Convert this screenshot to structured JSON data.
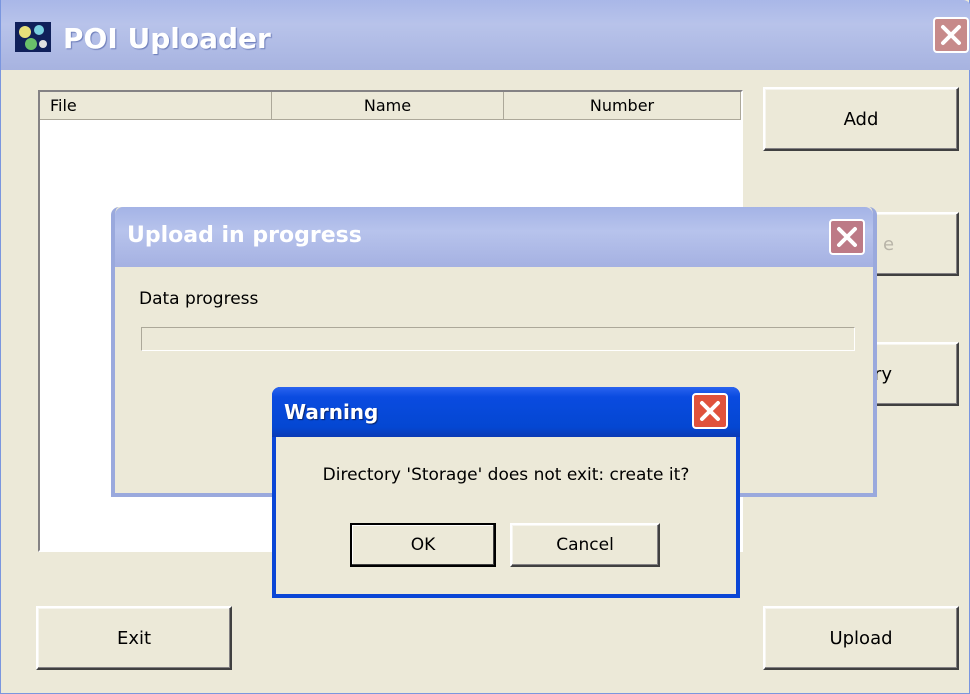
{
  "main_window": {
    "title": "POI Uploader",
    "icons": {
      "app": "poi-app-icon",
      "close": "close-icon"
    },
    "list_columns": [
      "File",
      "Name",
      "Number"
    ],
    "buttons": {
      "add": "Add",
      "remove_partial": "e",
      "directory_partial": "ory",
      "exit": "Exit",
      "upload": "Upload"
    }
  },
  "upload_dialog": {
    "title": "Upload in progress",
    "label": "Data progress",
    "progress": 0
  },
  "warning_dialog": {
    "title": "Warning",
    "message": "Directory 'Storage' does not exit: create it?",
    "ok_label": "OK",
    "cancel_label": "Cancel"
  },
  "colors": {
    "accent_blue": "#0a46d6",
    "inactive_title": "#a9b7e8",
    "window_face": "#ece9d8",
    "close_red": "#e0523c"
  }
}
